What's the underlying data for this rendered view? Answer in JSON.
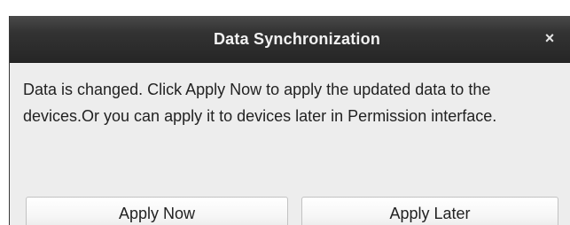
{
  "dialog": {
    "title": "Data Synchronization",
    "close_glyph": "×",
    "message": "Data is changed. Click Apply Now to apply the updated data to the devices.Or you can apply it to devices later in Permission interface.",
    "buttons": {
      "apply_now": "Apply Now",
      "apply_later": "Apply Later"
    }
  },
  "icons": {
    "close": "close-icon"
  },
  "colors": {
    "titlebar": "#2e2e2e",
    "title_text": "#f2f2f2",
    "body_background": "#ededed",
    "button_border": "#c2c2c2",
    "text": "#222222"
  }
}
